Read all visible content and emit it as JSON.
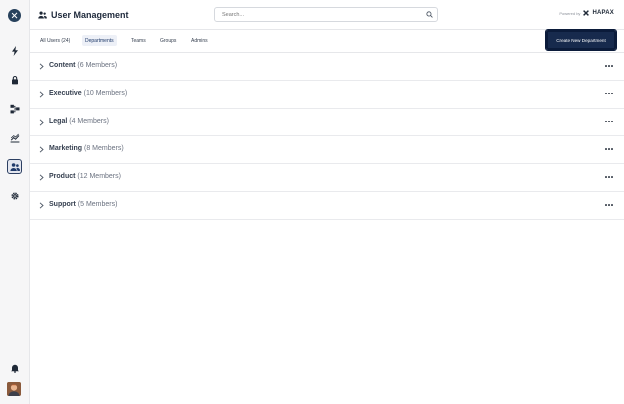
{
  "header": {
    "title": "User Management",
    "search_placeholder": "Search...",
    "powered_label": "Powered by",
    "brand": "HAPAX"
  },
  "tabs": [
    {
      "label": "All Users (24)",
      "active": false
    },
    {
      "label": "Departments",
      "active": true
    },
    {
      "label": "Teams",
      "active": false
    },
    {
      "label": "Groups",
      "active": false
    },
    {
      "label": "Admins",
      "active": false
    }
  ],
  "create_button_label": "Create New Department",
  "sidebar": {
    "items": [
      {
        "icon": "bolt-icon",
        "active": false
      },
      {
        "icon": "lock-icon",
        "active": false
      },
      {
        "icon": "workflow-icon",
        "active": false
      },
      {
        "icon": "analytics-icon",
        "active": false
      },
      {
        "icon": "users-icon",
        "active": true
      },
      {
        "icon": "gear-icon",
        "active": false
      }
    ],
    "bottom": [
      "bell-icon",
      "avatar"
    ]
  },
  "departments": [
    {
      "name": "Content",
      "count": "(6 Members)"
    },
    {
      "name": "Executive",
      "count": "(10 Members)"
    },
    {
      "name": "Legal",
      "count": "(4 Members)"
    },
    {
      "name": "Marketing",
      "count": "(8 Members)"
    },
    {
      "name": "Product",
      "count": "(12 Members)"
    },
    {
      "name": "Support",
      "count": "(5 Members)"
    }
  ],
  "colors": {
    "accent": "#172a4d",
    "rail_bg": "#f6f6f7",
    "active_tab_bg": "#edf0f7"
  }
}
